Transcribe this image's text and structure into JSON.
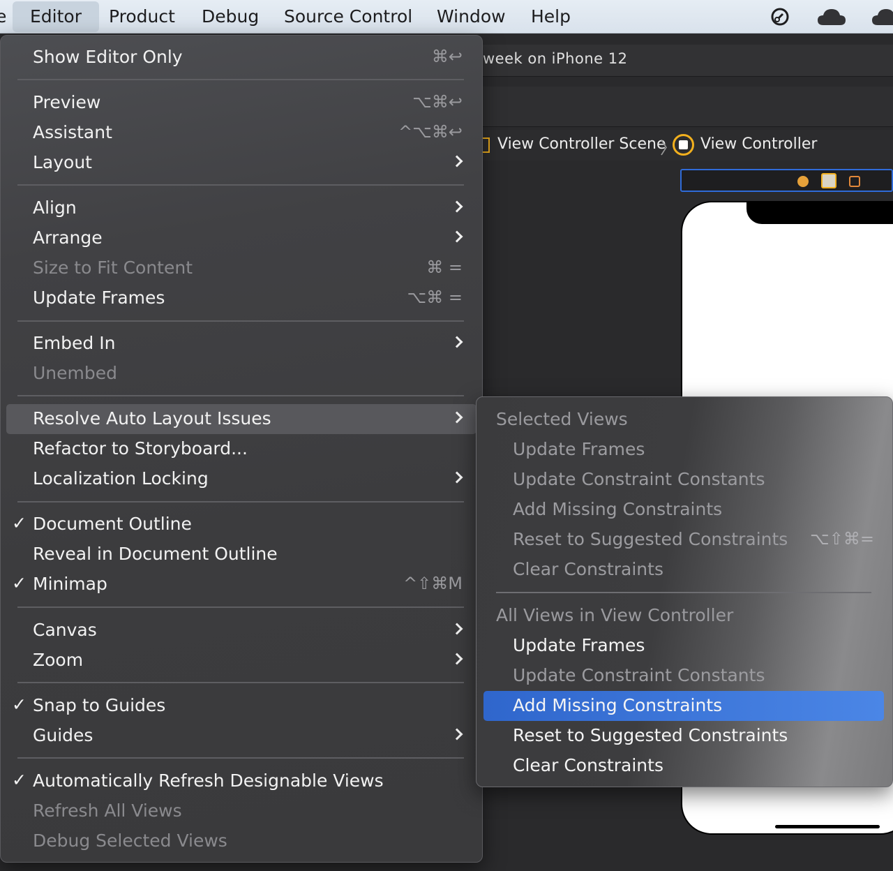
{
  "menubar": {
    "partial_left": "e",
    "items": [
      "Editor",
      "Product",
      "Debug",
      "Source Control",
      "Window",
      "Help"
    ],
    "active": "Editor",
    "status_icons": [
      "link-icon",
      "cloud-icon",
      "cloud-icon"
    ]
  },
  "xcode": {
    "scheme_text": "week on iPhone 12",
    "jumpbar": {
      "scene": "View Controller Scene",
      "controller": "View Controller"
    }
  },
  "editor_menu": {
    "items": [
      {
        "label": "Show Editor Only",
        "shortcut": "⌘↩",
        "enabled": true
      },
      {
        "label": "Preview",
        "shortcut": "⌥⌘↩",
        "enabled": true
      },
      {
        "label": "Assistant",
        "shortcut": "^⌥⌘↩",
        "enabled": true
      },
      {
        "label": "Layout",
        "submenu": true,
        "enabled": true
      },
      {
        "label": "Align",
        "submenu": true,
        "enabled": true
      },
      {
        "label": "Arrange",
        "submenu": true,
        "enabled": true
      },
      {
        "label": "Size to Fit Content",
        "shortcut": "⌘ =",
        "enabled": false
      },
      {
        "label": "Update Frames",
        "shortcut": "⌥⌘ =",
        "enabled": true
      },
      {
        "label": "Embed In",
        "submenu": true,
        "enabled": true
      },
      {
        "label": "Unembed",
        "enabled": false
      },
      {
        "label": "Resolve Auto Layout Issues",
        "submenu": true,
        "enabled": true,
        "highlighted": true
      },
      {
        "label": "Refactor to Storyboard...",
        "enabled": true
      },
      {
        "label": "Localization Locking",
        "submenu": true,
        "enabled": true
      },
      {
        "label": "Document Outline",
        "checked": true,
        "enabled": true
      },
      {
        "label": "Reveal in Document Outline",
        "enabled": true
      },
      {
        "label": "Minimap",
        "checked": true,
        "shortcut": "^⇧⌘M",
        "enabled": true
      },
      {
        "label": "Canvas",
        "submenu": true,
        "enabled": true
      },
      {
        "label": "Zoom",
        "submenu": true,
        "enabled": true
      },
      {
        "label": "Snap to Guides",
        "checked": true,
        "enabled": true
      },
      {
        "label": "Guides",
        "submenu": true,
        "enabled": true
      },
      {
        "label": "Automatically Refresh Designable Views",
        "checked": true,
        "enabled": true
      },
      {
        "label": "Refresh All Views",
        "enabled": false
      },
      {
        "label": "Debug Selected Views",
        "enabled": false
      }
    ]
  },
  "resolve_menu": {
    "selected_views": {
      "header": "Selected Views",
      "items": [
        {
          "label": "Update Frames",
          "enabled": false
        },
        {
          "label": "Update Constraint Constants",
          "enabled": false
        },
        {
          "label": "Add Missing Constraints",
          "enabled": false
        },
        {
          "label": "Reset to Suggested Constraints",
          "shortcut": "⌥⇧⌘=",
          "enabled": false
        },
        {
          "label": "Clear Constraints",
          "enabled": false
        }
      ]
    },
    "all_views": {
      "header": "All Views in View Controller",
      "items": [
        {
          "label": "Update Frames",
          "enabled": true
        },
        {
          "label": "Update Constraint Constants",
          "enabled": false
        },
        {
          "label": "Add Missing Constraints",
          "enabled": true,
          "selected": true
        },
        {
          "label": "Reset to Suggested Constraints",
          "enabled": true
        },
        {
          "label": "Clear Constraints",
          "enabled": true
        }
      ]
    }
  },
  "colors": {
    "selection_blue": "#3a74dc",
    "accent_yellow": "#f2b01e"
  }
}
